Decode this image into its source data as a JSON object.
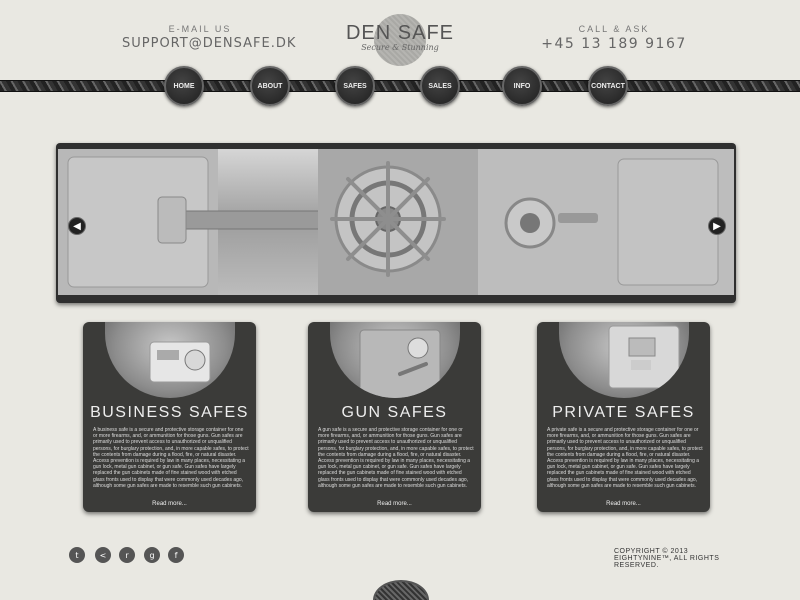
{
  "header": {
    "email_label": "E-MAIL US",
    "email_value": "SUPPORT@DENSAFE.DK",
    "phone_label": "CALL & ASK",
    "phone_value": "+45 13 189 9167",
    "logo_text": "DEN SAFE",
    "logo_tagline": "Secure & Stunning"
  },
  "nav": {
    "items": [
      {
        "label": "HOME"
      },
      {
        "label": "ABOUT"
      },
      {
        "label": "SAFES"
      },
      {
        "label": "SALES"
      },
      {
        "label": "INFO"
      },
      {
        "label": "CONTACT"
      }
    ]
  },
  "banner": {
    "prev_icon": "chevron-left-icon",
    "next_icon": "chevron-right-icon"
  },
  "cards": [
    {
      "title": "BUSINESS SAFES",
      "text": "A business safe is a secure and protective storage container for one or more firearms, and, or ammunition for those guns. Gun safes are primarily used to prevent access to unauthorized or unqualified persons, for burglary protection, and, in more capable safes, to protect the contents from damage during a flood, fire, or natural disaster. Access prevention is required by law in many places, necessitating a gun lock, metal gun cabinet, or gun safe. Gun safes have largely replaced the gun cabinets made of fine stained wood with etched glass fronts used to display that were commonly used decades ago, although some gun safes are made to resemble such gun cabinets.",
      "more": "Read more..."
    },
    {
      "title": "GUN SAFES",
      "text": "A gun safe is a secure and protective storage container for one or more firearms, and, or ammunition for those guns. Gun safes are primarily used to prevent access to unauthorized or unqualified persons, for burglary protection, and, in more capable safes, to protect the contents from damage during a flood, fire, or natural disaster. Access prevention is required by law in many places, necessitating a gun lock, metal gun cabinet, or gun safe. Gun safes have largely replaced the gun cabinets made of fine stained wood with etched glass fronts used to display that were commonly used decades ago, although some gun safes are made to resemble such gun cabinets.",
      "more": "Read more..."
    },
    {
      "title": "PRIVATE SAFES",
      "text": "A private safe is a secure and protective storage container for one or more firearms, and, or ammunition for those guns. Gun safes are primarily used to prevent access to unauthorized or unqualified persons, for burglary protection, and, in more capable safes, to protect the contents from damage during a flood, fire, or natural disaster. Access prevention is required by law in many places, necessitating a gun lock, metal gun cabinet, or gun safe. Gun safes have largely replaced the gun cabinets made of fine stained wood with etched glass fronts used to display that were commonly used decades ago, although some gun safes are made to resemble such gun cabinets.",
      "more": "Read more..."
    }
  ],
  "footer": {
    "social": [
      {
        "icon": "twitter-icon",
        "glyph": "t"
      },
      {
        "icon": "share-icon",
        "glyph": "<"
      },
      {
        "icon": "rss-icon",
        "glyph": "r"
      },
      {
        "icon": "google-plus-icon",
        "glyph": "g"
      },
      {
        "icon": "facebook-icon",
        "glyph": "f"
      }
    ],
    "copyright_line1": "COPYRIGHT © 2013",
    "copyright_line2": "EIGHTYNINE™, ALL RIGHTS",
    "copyright_line3": "RESERVED."
  },
  "colors": {
    "background": "#e9e8e2",
    "card_bg": "#3b3b39",
    "nav_bg": "#2a2a2a"
  }
}
